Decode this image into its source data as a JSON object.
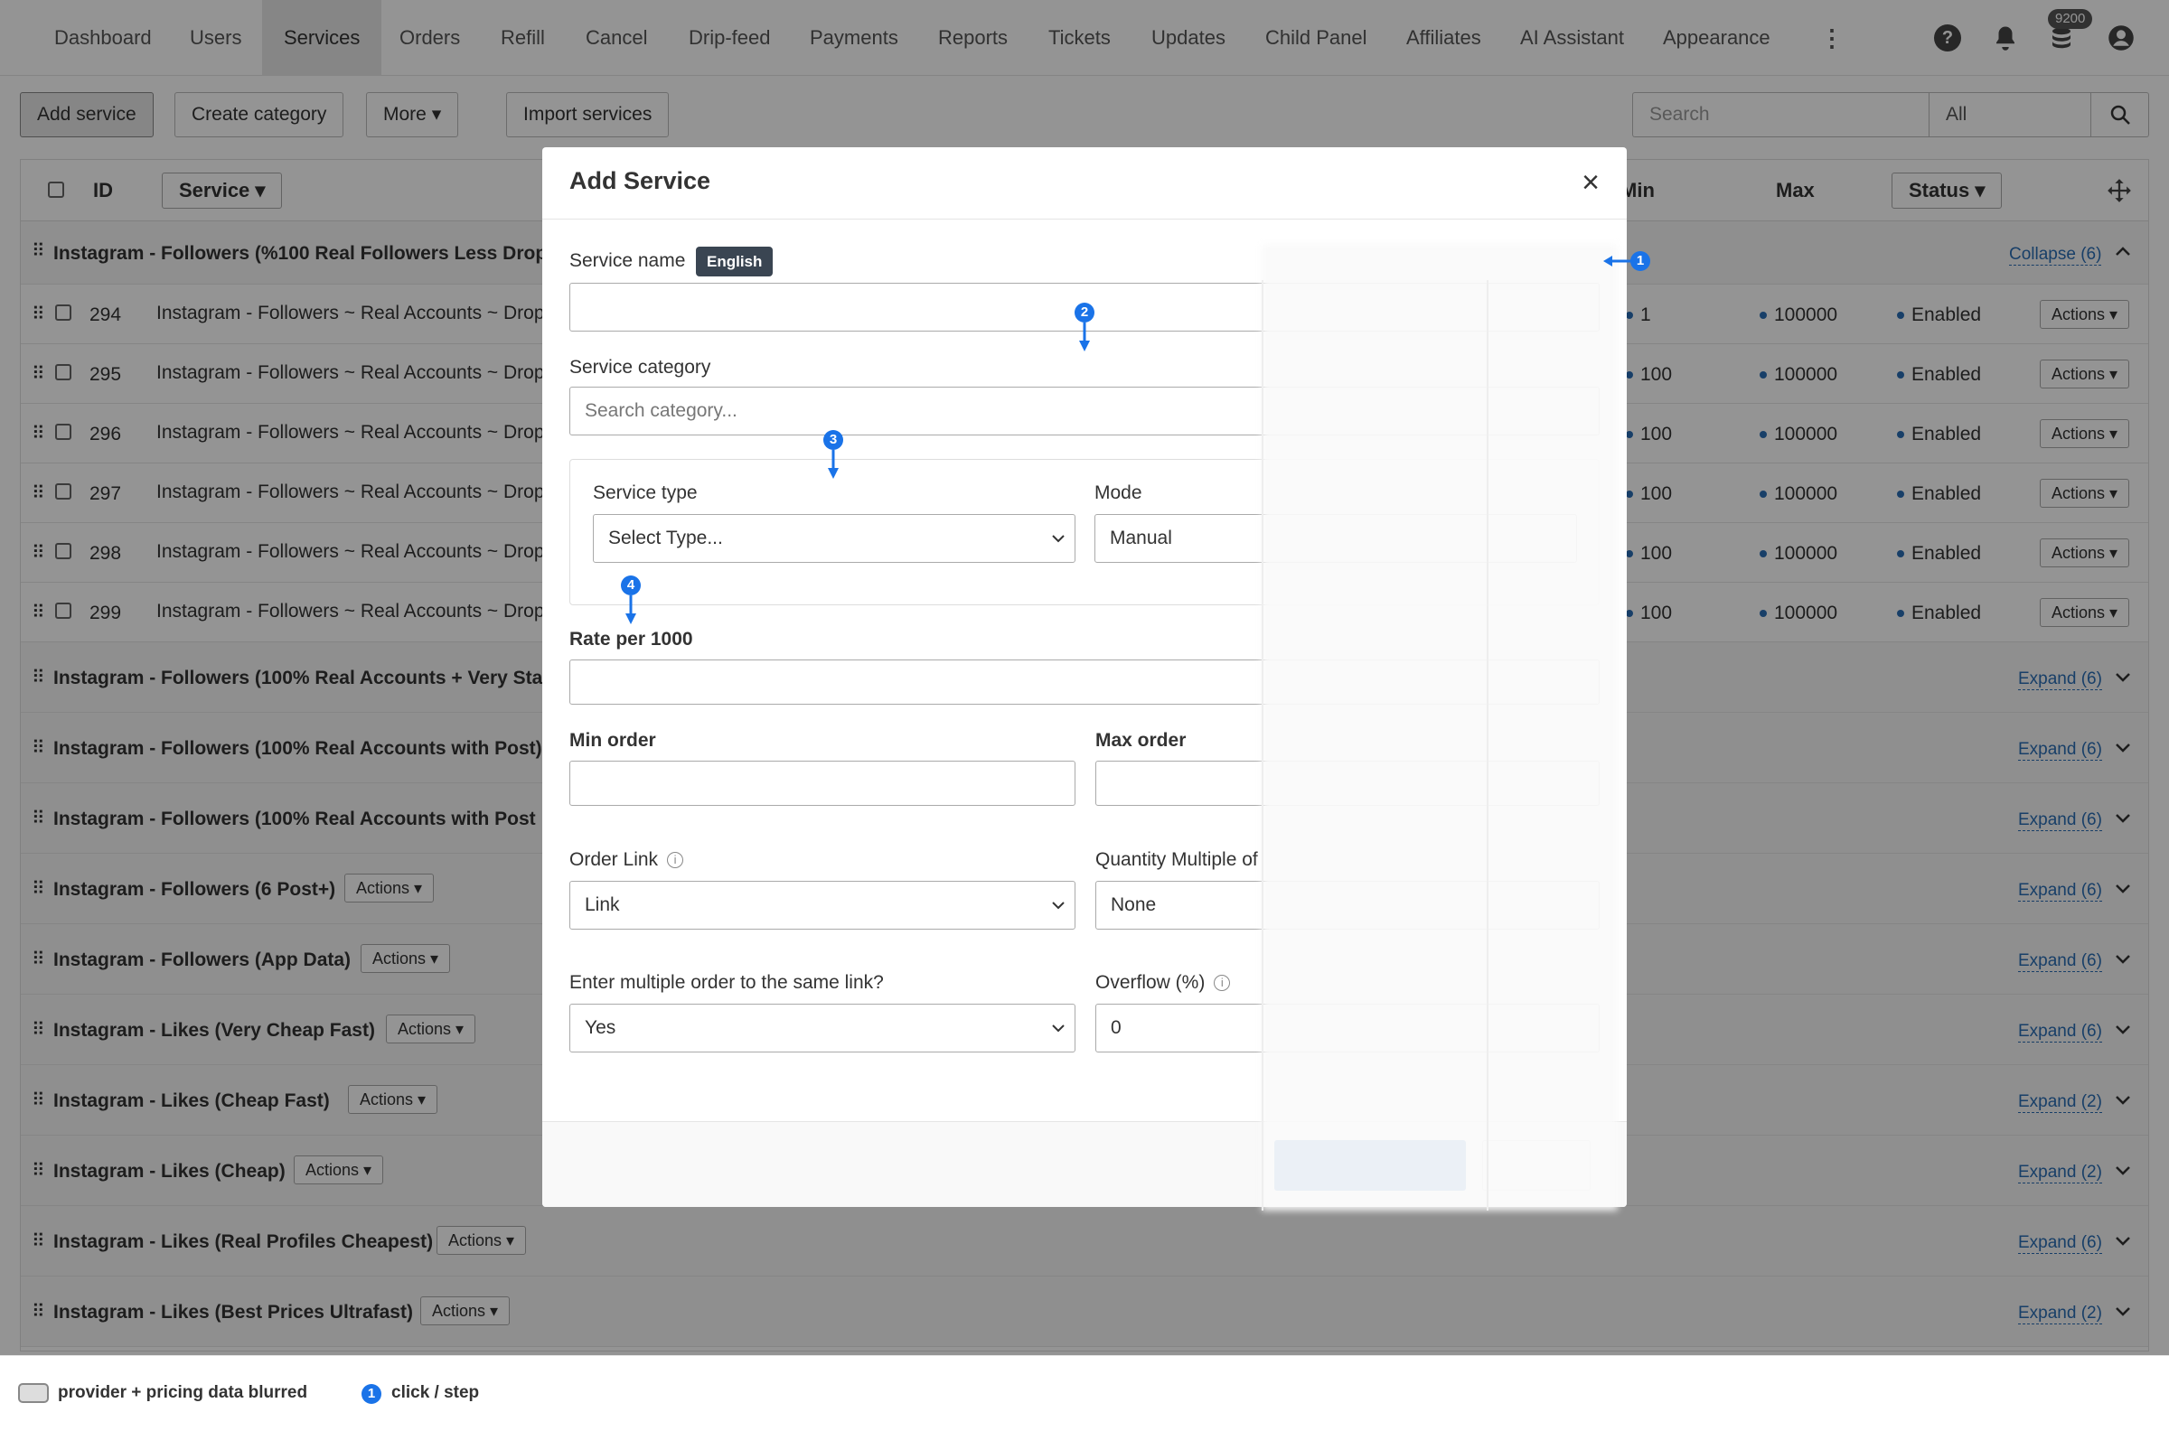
{
  "nav": {
    "items": [
      "Dashboard",
      "Users",
      "Services",
      "Orders",
      "Refill",
      "Cancel",
      "Drip-feed",
      "Payments",
      "Reports",
      "Tickets",
      "Updates",
      "Child Panel",
      "Affiliates",
      "AI Assistant",
      "Appearance"
    ],
    "active": "Services",
    "more_icon": "vertical-ellipsis-icon",
    "funds_badge": "9200"
  },
  "toolbar": {
    "add_service": "Add service",
    "create_category": "Create category",
    "more": "More",
    "import_services": "Import services",
    "search_placeholder": "Search",
    "search_scope": "All"
  },
  "table": {
    "headers": {
      "id": "ID",
      "service": "Service",
      "min": "Min",
      "max": "Max",
      "status": "Status"
    },
    "first_category": {
      "title": "Instagram - Followers (%100 Real Followers Less Drop",
      "toggle": "Collapse (6)"
    },
    "service_rows": [
      {
        "id": "294",
        "name": "Instagram - Followers ~ Real Accounts ~ Drop",
        "min": "1",
        "max": "100000",
        "status": "Enabled",
        "actions": "Actions"
      },
      {
        "id": "295",
        "name": "Instagram - Followers ~ Real Accounts ~ Drop",
        "min": "100",
        "max": "100000",
        "status": "Enabled",
        "actions": "Actions"
      },
      {
        "id": "296",
        "name": "Instagram - Followers ~ Real Accounts ~ Drop",
        "min": "100",
        "max": "100000",
        "status": "Enabled",
        "actions": "Actions"
      },
      {
        "id": "297",
        "name": "Instagram - Followers ~ Real Accounts ~ Drop",
        "min": "100",
        "max": "100000",
        "status": "Enabled",
        "actions": "Actions"
      },
      {
        "id": "298",
        "name": "Instagram - Followers ~ Real Accounts ~ Drop",
        "min": "100",
        "max": "100000",
        "status": "Enabled",
        "actions": "Actions"
      },
      {
        "id": "299",
        "name": "Instagram - Followers ~ Real Accounts ~ Drop",
        "min": "100",
        "max": "100000",
        "status": "Enabled",
        "actions": "Actions"
      }
    ],
    "categories": [
      {
        "title": "Instagram - Followers (100% Real Accounts + Very Sta",
        "actions": "",
        "toggle": "Expand (6)"
      },
      {
        "title": "Instagram - Followers (100% Real Accounts with Post)",
        "actions": "",
        "toggle": "Expand (6)"
      },
      {
        "title": "Instagram - Followers (100% Real Accounts with Post",
        "actions": "",
        "toggle": "Expand (6)"
      },
      {
        "title": "Instagram - Followers (6 Post+)",
        "actions": "Actions",
        "toggle": "Expand (6)"
      },
      {
        "title": "Instagram - Followers (App Data)",
        "actions": "Actions",
        "toggle": "Expand (6)"
      },
      {
        "title": "Instagram - Likes (Very Cheap Fast)",
        "actions": "Actions",
        "toggle": "Expand (6)"
      },
      {
        "title": "Instagram - Likes (Cheap Fast)",
        "actions": "Actions",
        "toggle": "Expand (2)"
      },
      {
        "title": "Instagram - Likes (Cheap)",
        "actions": "Actions",
        "toggle": "Expand (2)"
      },
      {
        "title": "Instagram - Likes (Real Profiles Cheapest)",
        "actions": "Actions",
        "toggle": "Expand (6)"
      },
      {
        "title": "Instagram - Likes (Best Prices Ultrafast)",
        "actions": "Actions",
        "toggle": "Expand (2)"
      }
    ]
  },
  "modal": {
    "title": "Add Service",
    "service_name_label": "Service name",
    "language_badge": "English",
    "service_name_value": "",
    "service_category_label": "Service category",
    "service_category_placeholder": "Search category...",
    "service_type_label": "Service type",
    "service_type_value": "Select Type...",
    "mode_label": "Mode",
    "mode_value": "Manual",
    "rate_label": "Rate per 1000",
    "rate_value": "",
    "min_order_label": "Min order",
    "min_order_value": "",
    "max_order_label": "Max order",
    "max_order_value": "",
    "order_link_label": "Order Link",
    "order_link_value": "Link",
    "quantity_multiple_label": "Quantity Multiple of",
    "quantity_multiple_value": "None",
    "multiple_order_label": "Enter multiple order to the same link?",
    "multiple_order_value": "Yes",
    "overflow_label": "Overflow (%)",
    "overflow_value": "0"
  },
  "steps": [
    "1",
    "2",
    "3",
    "4"
  ],
  "legend": {
    "blurred_text": "provider + pricing data blurred",
    "step_number": "1",
    "step_text": "click / step"
  },
  "colors": {
    "accent": "#1a73e8",
    "link": "#2a6db4",
    "primary_button": "#2a77c9"
  }
}
